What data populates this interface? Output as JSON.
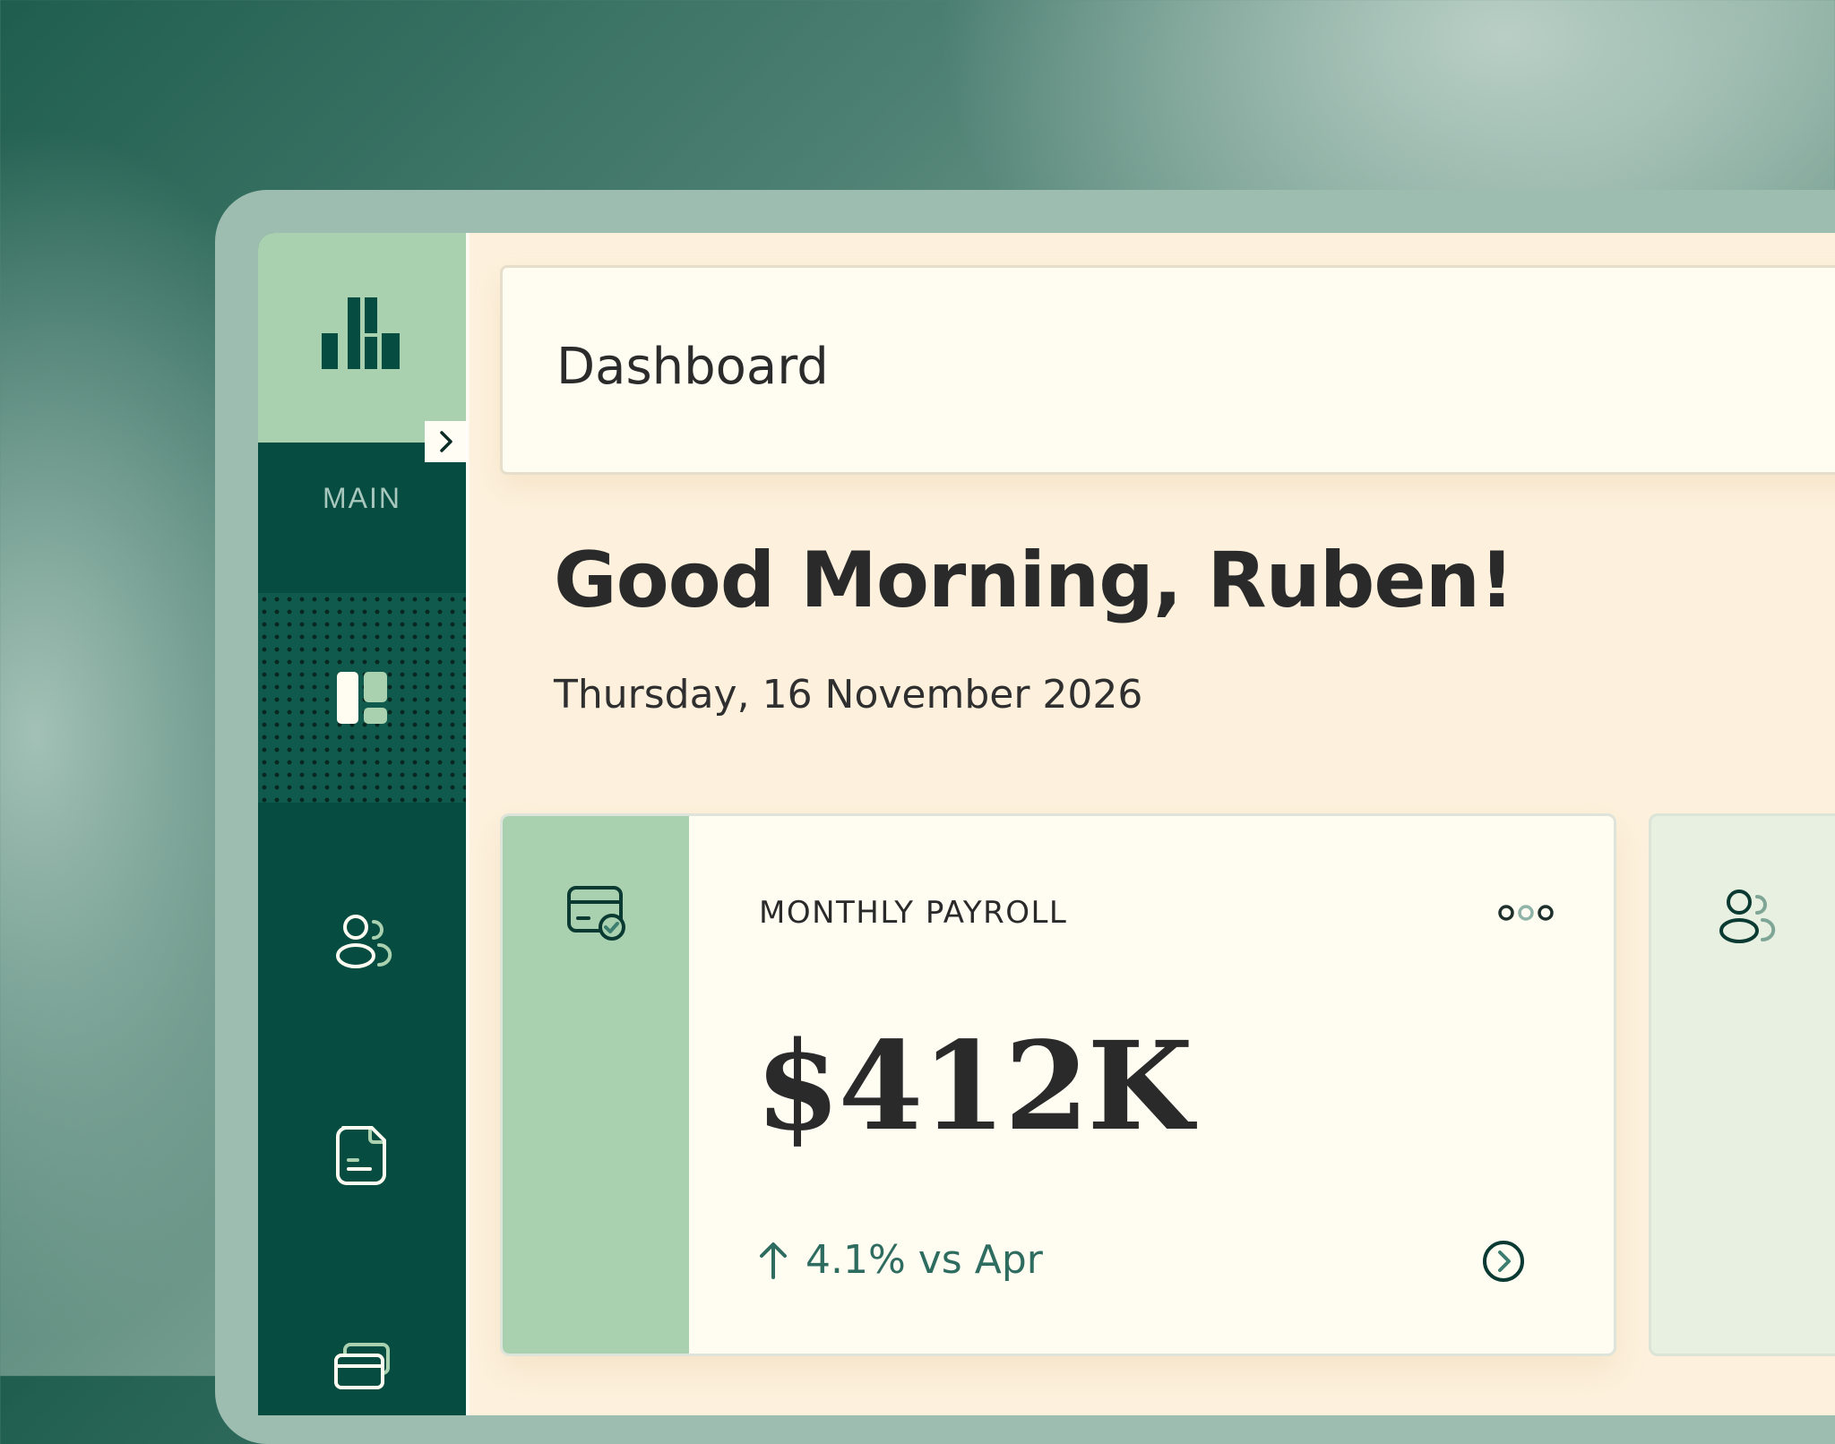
{
  "sidebar": {
    "section_label": "MAIN",
    "items": [
      {
        "name": "dashboard",
        "icon": "dashboard-icon",
        "active": true
      },
      {
        "name": "employees",
        "icon": "users-icon",
        "active": false
      },
      {
        "name": "documents",
        "icon": "document-icon",
        "active": false
      },
      {
        "name": "payments",
        "icon": "cards-icon",
        "active": false
      }
    ],
    "toggle_icon": "chevron-right-icon"
  },
  "header": {
    "title": "Dashboard"
  },
  "greeting": {
    "text": "Good Morning, Ruben!",
    "date": "Thursday, 16 November 2026"
  },
  "cards": [
    {
      "label": "MONTHLY PAYROLL",
      "value": "$412K",
      "change": "4.1% vs Apr",
      "icon": "credit-card-check-icon",
      "trend_icon": "arrow-up-icon",
      "action_icon": "chevron-circle-right-icon",
      "more_icon": "more-dots-icon"
    },
    {
      "icon": "users-icon"
    }
  ],
  "colors": {
    "sidebar_bg": "#064c40",
    "accent_green": "#a9d1af",
    "page_bg": "#fdf1dd",
    "card_bg": "#fffdf2",
    "trend_text": "#2f6c60"
  }
}
